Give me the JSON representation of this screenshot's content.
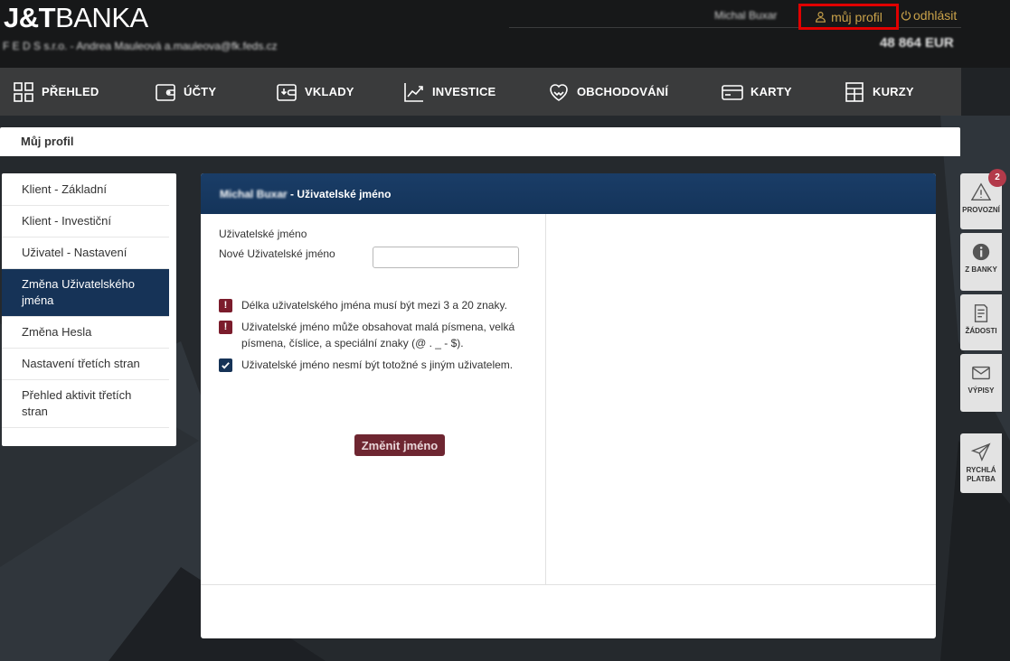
{
  "header": {
    "logo_bold": "J&T",
    "logo_thin": "BANKA",
    "company_line": "F E D S s.r.o. - Andrea Mauleová a.mauleova@fk.feds.cz",
    "user_name": "Michal Buxar",
    "profile_link": "můj profil",
    "logout_link": "odhlásit",
    "balance": "48 864 EUR"
  },
  "nav": {
    "items": [
      {
        "label": "PŘEHLED",
        "icon": "grid-icon"
      },
      {
        "label": "ÚČTY",
        "icon": "wallet-icon"
      },
      {
        "label": "VKLADY",
        "icon": "deposit-icon"
      },
      {
        "label": "INVESTICE",
        "icon": "chart-up-icon"
      },
      {
        "label": "OBCHODOVÁNÍ",
        "icon": "handshake-icon"
      },
      {
        "label": "KARTY",
        "icon": "card-icon"
      },
      {
        "label": "KURZY",
        "icon": "table-icon"
      }
    ]
  },
  "page": {
    "title": "Můj profil"
  },
  "sidemenu": {
    "items": [
      {
        "label": "Klient - Základní"
      },
      {
        "label": "Klient - Investiční"
      },
      {
        "label": "Uživatel - Nastavení"
      },
      {
        "label": "Změna Uživatelského jména",
        "active": true
      },
      {
        "label": "Změna Hesla"
      },
      {
        "label": "Nastavení třetích stran"
      },
      {
        "label": "Přehled aktivit třetích stran"
      }
    ]
  },
  "card": {
    "header_name": "Michal Buxar",
    "header_suffix": " - Uživatelské jméno",
    "username_label": "Uživatelské jméno",
    "new_username_label": "Nové Uživatelské jméno",
    "new_username_value": "",
    "rules": [
      {
        "status": "warning",
        "text": "Délka uživatelského jména musí být mezi 3 a 20 znaky."
      },
      {
        "status": "warning",
        "text": "Uživatelské jméno může obsahovat malá písmena, velká písmena, číslice, a speciální znaky (@ . _ - $)."
      },
      {
        "status": "ok",
        "text": "Uživatelské jméno nesmí být totožné s jiným uživatelem."
      }
    ],
    "submit_label": "Změnit jméno"
  },
  "quickbar": {
    "notification_count": "2",
    "items": [
      {
        "label": "PROVOZNÍ",
        "icon": "warning-icon"
      },
      {
        "label": "Z BANKY",
        "icon": "info-icon"
      },
      {
        "label": "ŽÁDOSTI",
        "icon": "document-icon"
      },
      {
        "label": "VÝPISY",
        "icon": "envelope-icon"
      },
      {
        "label": "RYCHLÁ PLATBA",
        "icon": "send-icon"
      }
    ]
  },
  "colors": {
    "accent_gold": "#c9a24a",
    "navy": "#163357",
    "burgundy": "#6e2631",
    "highlight_red": "#e00000"
  }
}
